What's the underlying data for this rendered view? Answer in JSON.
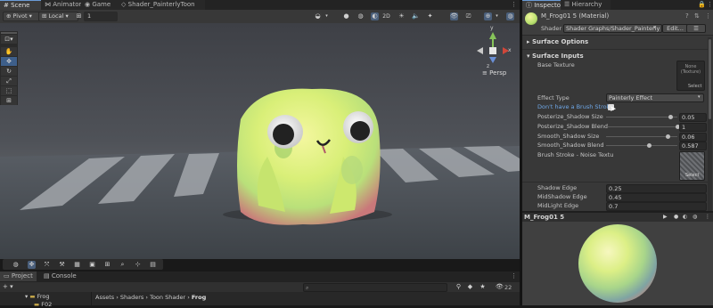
{
  "scene": {
    "tabs": [
      {
        "label": "Scene",
        "icon": "hash-icon"
      },
      {
        "label": "Animator",
        "icon": "animator-icon"
      },
      {
        "label": "Game",
        "icon": "gamepad-icon"
      },
      {
        "label": "Shader_PainterlyToon",
        "icon": "shader-icon"
      }
    ],
    "toolbar": {
      "pivot": "Pivot",
      "local": "Local",
      "snap_value": "1",
      "mode_2d": "2D"
    },
    "gizmo": {
      "projection": "Persp",
      "y": "y",
      "x": "x",
      "z": "z"
    },
    "tools": [
      "view-tool",
      "move-tool",
      "rotate-tool",
      "scale-tool",
      "rect-tool",
      "transform-tool"
    ]
  },
  "inspector": {
    "tabs": [
      {
        "label": "Inspector",
        "icon": "info-icon"
      },
      {
        "label": "Hierarchy",
        "icon": "hierarchy-icon"
      }
    ],
    "material_name": "M_Frog01 5 (Material)",
    "shader_label": "Shader",
    "shader_value": "Shader Graphs/Shader_Painterly",
    "edit_label": "Edit...",
    "sections": {
      "surface_options": "Surface Options",
      "surface_inputs": "Surface Inputs"
    },
    "base_texture": {
      "label": "Base Texture",
      "thumb_text": "None\n(Texture)",
      "select": "Select"
    },
    "effect_type": {
      "label": "Effect Type",
      "value": "Painterly Effect"
    },
    "brush_link": "Don't have a Brush Stroke",
    "sliders": [
      {
        "label": "Posterize_Shadow Size",
        "value": "0.05",
        "fraction": 0.9
      },
      {
        "label": "Posterize_Shadow Blend",
        "value": "1",
        "fraction": 1.0
      },
      {
        "label": "Smooth_Shadow Size",
        "value": "0.06",
        "fraction": 0.87
      },
      {
        "label": "Smooth_Shadow Blend",
        "value": "0.587",
        "fraction": 0.6
      }
    ],
    "noise": {
      "label": "Brush Stroke - Noise Textu",
      "select": "Select"
    },
    "edges": [
      {
        "label": "Shadow Edge",
        "value": "0.25"
      },
      {
        "label": "MidShadow Edge",
        "value": "0.45"
      },
      {
        "label": "MidLight Edge",
        "value": "0.7"
      }
    ],
    "preview_title": "M_Frog01 5"
  },
  "bottom": {
    "tabs": [
      {
        "label": "Project",
        "icon": "folder-icon"
      },
      {
        "label": "Console",
        "icon": "console-icon"
      }
    ],
    "breadcrumb": [
      "Assets",
      "Shaders",
      "Toon Shader",
      "Frog"
    ],
    "tree": [
      {
        "label": "Frog"
      },
      {
        "label": "F02"
      }
    ],
    "count": "22"
  },
  "colors": {
    "accent": "#4a7bc4",
    "frog_body": "#e7f27a",
    "link": "#6fa8e8"
  }
}
